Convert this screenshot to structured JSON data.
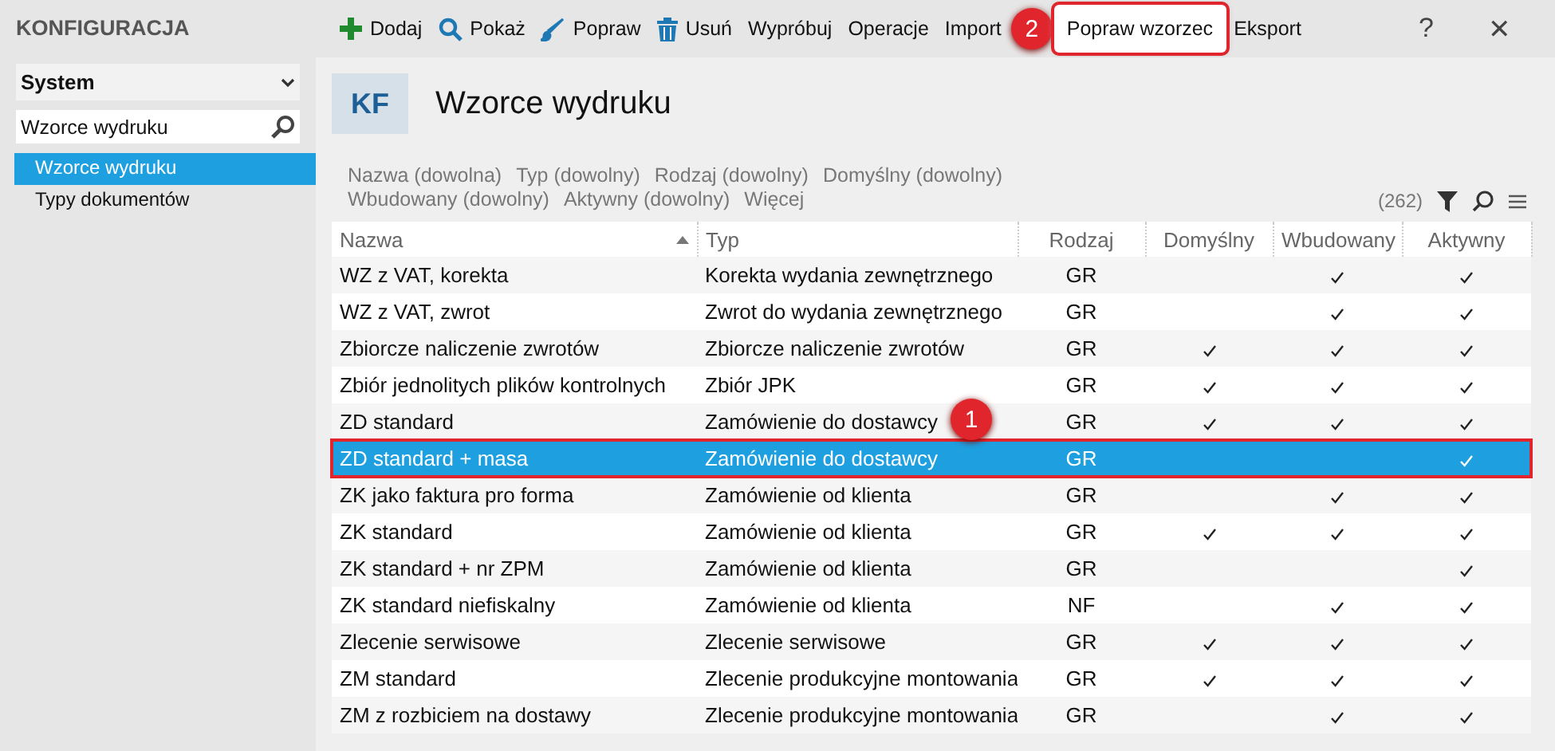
{
  "sidebar": {
    "title": "KONFIGURACJA",
    "dropdown": {
      "value": "System"
    },
    "search": {
      "value": "Wzorce wydruku"
    },
    "items": [
      {
        "label": "Wzorce wydruku",
        "selected": true
      },
      {
        "label": "Typy dokumentów",
        "selected": false
      }
    ]
  },
  "toolbar": {
    "buttons": [
      {
        "label": "Dodaj",
        "kind": "add",
        "highlighted": false
      },
      {
        "label": "Pokaż",
        "kind": "view",
        "highlighted": false
      },
      {
        "label": "Popraw",
        "kind": "edit",
        "highlighted": false
      },
      {
        "label": "Usuń",
        "kind": "delete",
        "highlighted": false
      },
      {
        "label": "Wypróbuj",
        "kind": "text",
        "highlighted": false
      },
      {
        "label": "Operacje",
        "kind": "text",
        "highlighted": false
      },
      {
        "label": "Import",
        "kind": "text",
        "highlighted": false
      },
      {
        "label": "Popraw wzorzec",
        "kind": "text",
        "highlighted": true
      },
      {
        "label": "Eksport",
        "kind": "text",
        "highlighted": false
      }
    ],
    "help": "?",
    "close": "✕"
  },
  "header": {
    "badge": "KF",
    "title": "Wzorce wydruku"
  },
  "filters": [
    "Nazwa (dowolna)",
    "Typ (dowolny)",
    "Rodzaj (dowolny)",
    "Domyślny (dowolny)",
    "Wbudowany (dowolny)",
    "Aktywny (dowolny)",
    "Więcej"
  ],
  "count": "(262)",
  "table": {
    "columns": [
      "Nazwa",
      "Typ",
      "Rodzaj",
      "Domyślny",
      "Wbudowany",
      "Aktywny"
    ],
    "rows": [
      {
        "name": "WZ z VAT, korekta",
        "type": "Korekta wydania zewnętrznego",
        "kind": "GR",
        "default": false,
        "builtin": true,
        "active": true,
        "selected": false
      },
      {
        "name": "WZ z VAT, zwrot",
        "type": "Zwrot do wydania zewnętrznego",
        "kind": "GR",
        "default": false,
        "builtin": true,
        "active": true,
        "selected": false
      },
      {
        "name": "Zbiorcze naliczenie zwrotów",
        "type": "Zbiorcze naliczenie zwrotów",
        "kind": "GR",
        "default": true,
        "builtin": true,
        "active": true,
        "selected": false
      },
      {
        "name": "Zbiór jednolitych plików kontrolnych",
        "type": "Zbiór JPK",
        "kind": "GR",
        "default": true,
        "builtin": true,
        "active": true,
        "selected": false
      },
      {
        "name": "ZD standard",
        "type": "Zamówienie do dostawcy",
        "kind": "GR",
        "default": true,
        "builtin": true,
        "active": true,
        "selected": false
      },
      {
        "name": "ZD standard + masa",
        "type": "Zamówienie do dostawcy",
        "kind": "GR",
        "default": false,
        "builtin": false,
        "active": true,
        "selected": true
      },
      {
        "name": "ZK jako faktura pro forma",
        "type": "Zamówienie od klienta",
        "kind": "GR",
        "default": false,
        "builtin": true,
        "active": true,
        "selected": false
      },
      {
        "name": "ZK standard",
        "type": "Zamówienie od klienta",
        "kind": "GR",
        "default": true,
        "builtin": true,
        "active": true,
        "selected": false
      },
      {
        "name": "ZK standard + nr ZPM",
        "type": "Zamówienie od klienta",
        "kind": "GR",
        "default": false,
        "builtin": false,
        "active": true,
        "selected": false
      },
      {
        "name": "ZK standard niefiskalny",
        "type": "Zamówienie od klienta",
        "kind": "NF",
        "default": false,
        "builtin": true,
        "active": true,
        "selected": false
      },
      {
        "name": "Zlecenie serwisowe",
        "type": "Zlecenie serwisowe",
        "kind": "GR",
        "default": true,
        "builtin": true,
        "active": true,
        "selected": false
      },
      {
        "name": "ZM standard",
        "type": "Zlecenie produkcyjne montowania",
        "kind": "GR",
        "default": true,
        "builtin": true,
        "active": true,
        "selected": false
      },
      {
        "name": "ZM z rozbiciem na dostawy",
        "type": "Zlecenie produkcyjne montowania",
        "kind": "GR",
        "default": false,
        "builtin": true,
        "active": true,
        "selected": false
      }
    ]
  },
  "callouts": [
    "1",
    "2"
  ]
}
